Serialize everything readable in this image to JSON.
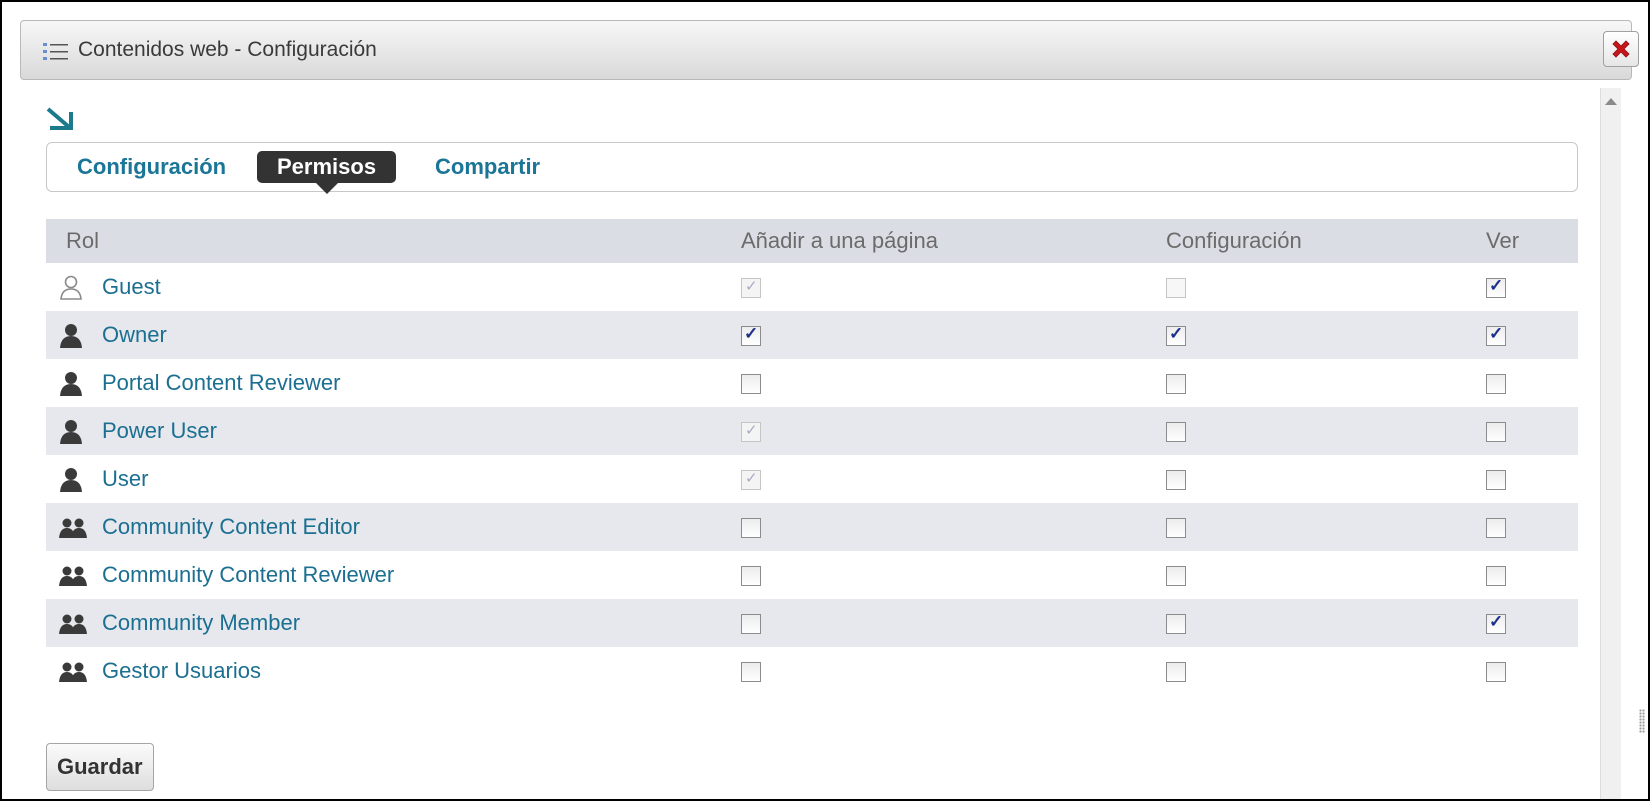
{
  "window": {
    "title": "Contenidos web - Configuración",
    "title_icon": "list-icon",
    "close_icon": "close-icon"
  },
  "tabs": [
    {
      "label": "Configuración",
      "active": false
    },
    {
      "label": "Permisos",
      "active": true
    },
    {
      "label": "Compartir",
      "active": false
    }
  ],
  "table": {
    "headers": [
      "Rol",
      "Añadir a una página",
      "Configuración",
      "Ver"
    ],
    "rows": [
      {
        "role": "Guest",
        "icon": "guest-user-icon",
        "add": "disabled-checked",
        "config": "disabled",
        "view": "checked"
      },
      {
        "role": "Owner",
        "icon": "user-icon",
        "add": "checked",
        "config": "checked",
        "view": "checked"
      },
      {
        "role": "Portal Content Reviewer",
        "icon": "user-icon",
        "add": "unchecked",
        "config": "unchecked",
        "view": "unchecked"
      },
      {
        "role": "Power User",
        "icon": "user-icon",
        "add": "disabled-checked",
        "config": "unchecked",
        "view": "unchecked"
      },
      {
        "role": "User",
        "icon": "user-icon",
        "add": "disabled-checked",
        "config": "unchecked",
        "view": "unchecked"
      },
      {
        "role": "Community Content Editor",
        "icon": "group-icon",
        "add": "unchecked",
        "config": "unchecked",
        "view": "unchecked"
      },
      {
        "role": "Community Content Reviewer",
        "icon": "group-icon",
        "add": "unchecked",
        "config": "unchecked",
        "view": "unchecked"
      },
      {
        "role": "Community Member",
        "icon": "group-icon",
        "add": "unchecked",
        "config": "unchecked",
        "view": "checked"
      },
      {
        "role": "Gestor Usuarios",
        "icon": "group-icon",
        "add": "unchecked",
        "config": "unchecked",
        "view": "unchecked"
      }
    ]
  },
  "actions": {
    "save_label": "Guardar"
  },
  "colors": {
    "accent": "#1b7597",
    "active_tab_bg": "#333333",
    "header_bg": "#dadee4",
    "alt_row_bg": "#e6e8ee",
    "close_red": "#c8171c"
  }
}
